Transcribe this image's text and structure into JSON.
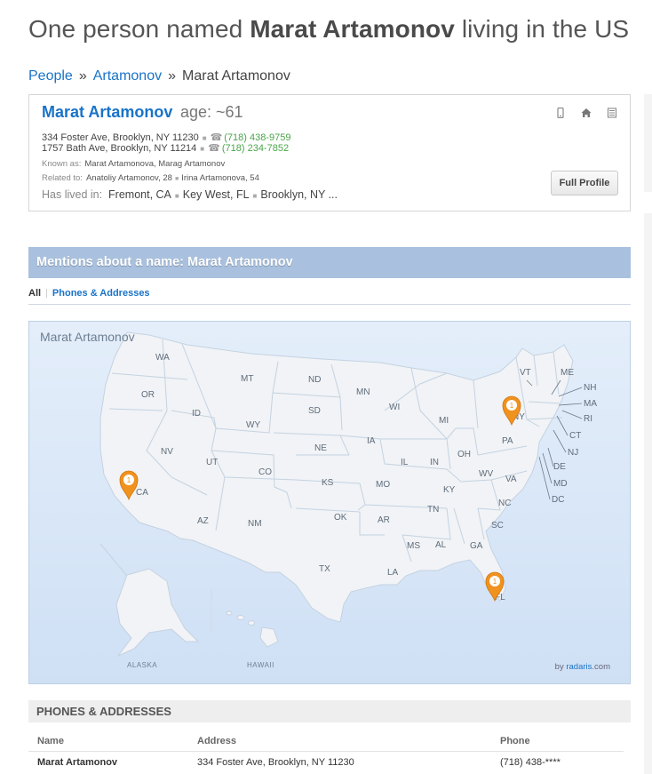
{
  "title": {
    "pre": "One person named ",
    "name": "Marat Artamonov",
    "post": " living in the US"
  },
  "breadcrumb": [
    "People",
    "Artamonov",
    "Marat Artamonov"
  ],
  "breadcrumb_sep": "»",
  "person": {
    "name": "Marat Artamonov",
    "age": "age: ~61",
    "addresses": [
      {
        "address": "334 Foster Ave, Brooklyn, NY 11230",
        "phone": "(718) 438-9759"
      },
      {
        "address": "1757 Bath Ave, Brooklyn, NY 11214",
        "phone": "(718) 234-7852"
      }
    ],
    "known_as_label": "Known as:",
    "known_as": "Marat Artamonova, Marag Artamonov",
    "related_label": "Related to:",
    "related": [
      "Anatoliy Artamonov, 28",
      "Irina Artamonova, 54"
    ],
    "lived_label": "Has lived in:",
    "lived": [
      "Fremont, CA",
      "Key West, FL",
      "Brooklyn, NY ..."
    ],
    "full_profile": "Full Profile"
  },
  "mentions": {
    "title": "Mentions about a name: Marat Artamonov",
    "tab_all": "All",
    "tab_phones": "Phones & Addresses"
  },
  "map": {
    "title": "Marat Artamonov",
    "credit_pre": "by ",
    "credit_brand": "radaris",
    "credit_post": ".com",
    "alaska": "ALASKA",
    "hawaii": "HAWAII",
    "pin_label": "1",
    "pins": [
      "NY",
      "CA",
      "FL"
    ],
    "pin_color": "#f0921e",
    "states": [
      "WA",
      "OR",
      "CA",
      "NV",
      "ID",
      "MT",
      "WY",
      "UT",
      "AZ",
      "CO",
      "NM",
      "ND",
      "SD",
      "NE",
      "KS",
      "OK",
      "TX",
      "MN",
      "IA",
      "MO",
      "AR",
      "LA",
      "WI",
      "IL",
      "MI",
      "IN",
      "OH",
      "KY",
      "TN",
      "MS",
      "AL",
      "GA",
      "FL",
      "SC",
      "NC",
      "VA",
      "WV",
      "PA",
      "NY",
      "VT",
      "ME",
      "NH",
      "MA",
      "RI",
      "CT",
      "NJ",
      "DE",
      "MD",
      "DC"
    ]
  },
  "phones_section": {
    "title": "PHONES & ADDRESSES",
    "headers": [
      "Name",
      "Address",
      "Phone"
    ],
    "rows": [
      [
        "Marat Artamonov",
        "334 Foster Ave, Brooklyn, NY 11230",
        "(718) 438-****"
      ]
    ]
  },
  "colors": {
    "link": "#1a73c8",
    "phone": "#4aa54a",
    "mentions_bar": "#a9c1de"
  }
}
